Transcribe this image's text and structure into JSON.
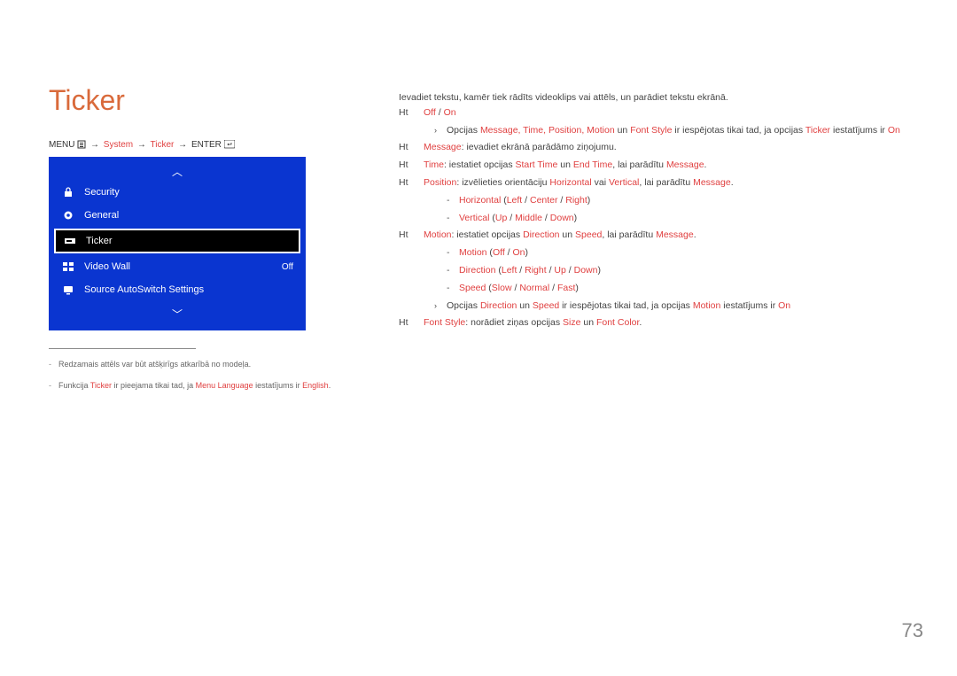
{
  "title": "Ticker",
  "breadcrumb": {
    "menu": "MENU",
    "path1": "System",
    "path2": "Ticker",
    "enter": "ENTER"
  },
  "menu": {
    "items": [
      {
        "label": "Security"
      },
      {
        "label": "General"
      },
      {
        "label": "Ticker"
      },
      {
        "label": "Video Wall",
        "value": "Off"
      },
      {
        "label": "Source AutoSwitch Settings"
      }
    ]
  },
  "notes": {
    "n1": "Redzamais attēls var būt atšķirīgs atkarībā no modeļa.",
    "n2_pre": "Funkcija ",
    "n2_a": "Ticker",
    "n2_mid": " ir pieejama tikai tad, ja ",
    "n2_b": "Menu Language",
    "n2_mid2": " iestatījums ir ",
    "n2_c": "English",
    "n2_end": "."
  },
  "desc": {
    "intro": "Ievadiet tekstu, kamēr tiek rādīts videoklips vai attēls, un parādiet tekstu ekrānā.",
    "b1": {
      "a": "Off",
      "sep": " / ",
      "b": "On"
    },
    "b1_sub": {
      "pre": "Opcijas ",
      "list": "Message, Time, Position, Motion",
      "mid": " un ",
      "fs": "Font Style",
      "mid2": " ir iespējotas tikai tad, ja opcijas ",
      "tk": "Ticker",
      "mid3": " iestatījums ir ",
      "on": "On"
    },
    "b2": {
      "a": "Message",
      "rest": ": ievadiet ekrānā parādāmo ziņojumu."
    },
    "b3": {
      "a": "Time",
      "mid": ": iestatiet opcijas ",
      "st": "Start Time",
      "and": " un ",
      "et": "End Time",
      "rest": ", lai parādītu ",
      "msg": "Message",
      "end": "."
    },
    "b4": {
      "a": "Position",
      "mid": ": izvēlieties orientāciju ",
      "h": "Horizontal",
      "or": " vai ",
      "v": "Vertical",
      "rest": ", lai parādītu ",
      "msg": "Message",
      "end": "."
    },
    "b4_s1": {
      "a": "Horizontal",
      "o": " (",
      "l": "Left",
      "s": " / ",
      "c": "Center",
      "r": "Right",
      "cl": ")"
    },
    "b4_s2": {
      "a": "Vertical",
      "o": " (",
      "u": "Up",
      "s": " / ",
      "m": "Middle",
      "d": "Down",
      "cl": ")"
    },
    "b5": {
      "a": "Motion",
      "mid": ": iestatiet opcijas ",
      "dir": "Direction",
      "and": " un ",
      "sp": "Speed",
      "rest": ", lai parādītu ",
      "msg": "Message",
      "end": "."
    },
    "b5_s1": {
      "a": "Motion",
      "o": " (",
      "off": "Off",
      "s": " / ",
      "on": "On",
      "cl": ")"
    },
    "b5_s2": {
      "a": "Direction",
      "o": " (",
      "l": "Left",
      "s": " / ",
      "r": "Right",
      "u": "Up",
      "d": "Down",
      "cl": ")"
    },
    "b5_s3": {
      "a": "Speed",
      "o": " (",
      "sl": "Slow",
      "s": " / ",
      "n": "Normal",
      "f": "Fast",
      "cl": ")"
    },
    "b5_sub": {
      "pre": "Opcijas ",
      "dir": "Direction",
      "and": " un ",
      "sp": "Speed",
      "mid": " ir iespējotas tikai tad, ja opcijas ",
      "mo": "Motion",
      "mid2": " iestatījums ir ",
      "on": "On"
    },
    "b6": {
      "a": "Font Style",
      "mid": ": norādiet ziņas opcijas ",
      "sz": "Size",
      "and": " un ",
      "fc": "Font Color",
      "end": "."
    }
  },
  "page_number": "73"
}
